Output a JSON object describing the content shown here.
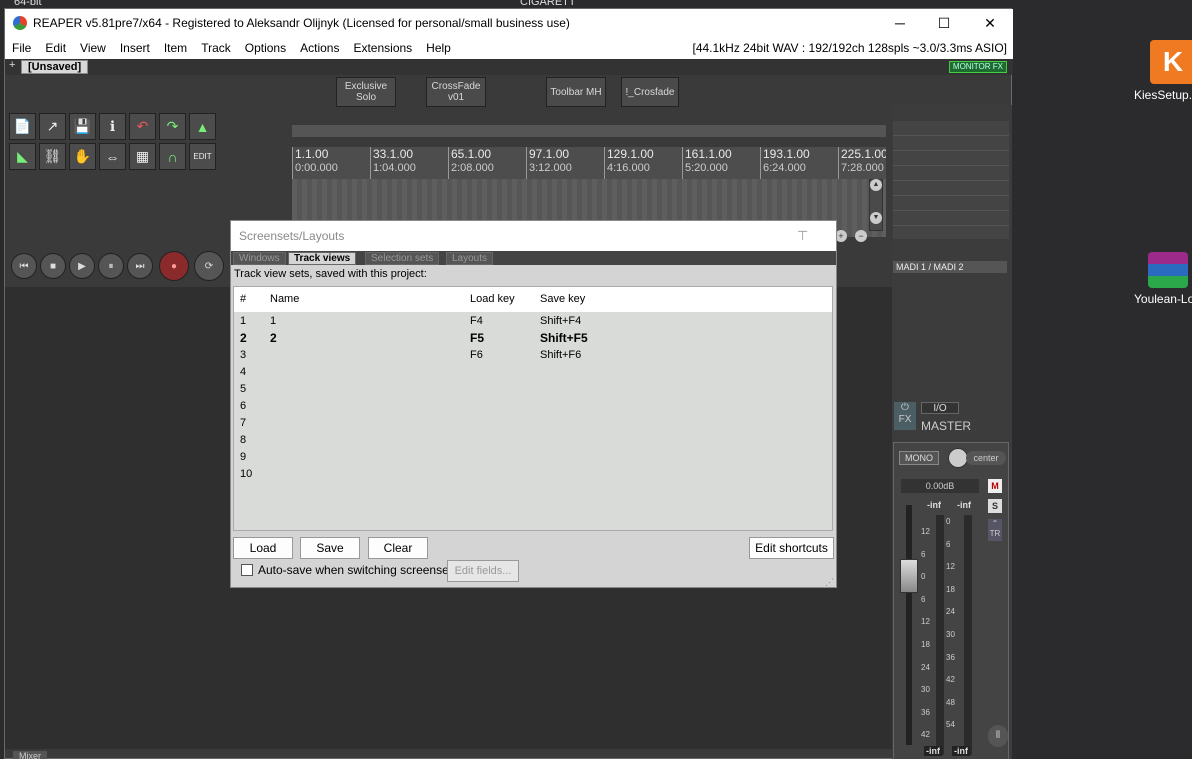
{
  "window": {
    "title": "REAPER v5.81pre7/x64 - Registered to Aleksandr Olijnyk (Licensed for personal/small business use)",
    "minimize": "─",
    "maximize": "☐",
    "close": "✕"
  },
  "menu": {
    "items": [
      "File",
      "Edit",
      "View",
      "Insert",
      "Item",
      "Track",
      "Options",
      "Actions",
      "Extensions",
      "Help"
    ],
    "status": "[44.1kHz 24bit WAV : 192/192ch 128spls ~3.0/3.3ms ASIO]"
  },
  "project": {
    "add_tab": "+",
    "tab_label": "[Unsaved]",
    "monitor_fx": "MONITOR FX"
  },
  "toolbar_buttons": [
    {
      "label": "Exclusive\nSolo"
    },
    {
      "label": "CrossFade\nv01"
    },
    {
      "label": "Toolbar MH"
    },
    {
      "label": "!_Crosfade"
    }
  ],
  "ruler": [
    {
      "bar": "1.1.00",
      "time": "0:00.000"
    },
    {
      "bar": "33.1.00",
      "time": "1:04.000"
    },
    {
      "bar": "65.1.00",
      "time": "2:08.000"
    },
    {
      "bar": "97.1.00",
      "time": "3:12.000"
    },
    {
      "bar": "129.1.00",
      "time": "4:16.000"
    },
    {
      "bar": "161.1.00",
      "time": "5:20.000"
    },
    {
      "bar": "193.1.00",
      "time": "6:24.000"
    },
    {
      "bar": "225.1.00",
      "time": "7:28.000"
    }
  ],
  "mixer": {
    "input": "MADI 1 / MADI 2",
    "io": "I/O",
    "master": "MASTER",
    "mono": "MONO",
    "pan": "center",
    "db": "0.00dB",
    "peak_l": "-inf",
    "peak_r": "-inf",
    "m": "M",
    "s": "S",
    "tr": "TR",
    "fx": "FX",
    "scale_left": [
      "12",
      "6",
      "0",
      "6",
      "12",
      "18",
      "24",
      "30",
      "36",
      "42"
    ],
    "scale_mid": [
      "0",
      "6",
      "12",
      "18",
      "24",
      "30",
      "36",
      "42",
      "48",
      "54"
    ],
    "bottom_l": "-inf",
    "bottom_r": "-inf",
    "mixer_tab": "Mixer"
  },
  "dialog": {
    "title": "Screensets/Layouts",
    "tabs": [
      "Windows",
      "Track views",
      "Selection sets",
      "Layouts"
    ],
    "subtitle": "Track view sets, saved with this project:",
    "columns": {
      "num": "#",
      "name": "Name",
      "load": "Load key",
      "save": "Save key"
    },
    "rows": [
      {
        "num": "1",
        "name": "1",
        "load": "F4",
        "save": "Shift+F4",
        "bold": false
      },
      {
        "num": "2",
        "name": "2",
        "load": "F5",
        "save": "Shift+F5",
        "bold": true
      },
      {
        "num": "3",
        "name": "",
        "load": "F6",
        "save": "Shift+F6",
        "bold": false
      },
      {
        "num": "4",
        "name": "",
        "load": "",
        "save": "",
        "bold": false
      },
      {
        "num": "5",
        "name": "",
        "load": "",
        "save": "",
        "bold": false
      },
      {
        "num": "6",
        "name": "",
        "load": "",
        "save": "",
        "bold": false
      },
      {
        "num": "7",
        "name": "",
        "load": "",
        "save": "",
        "bold": false
      },
      {
        "num": "8",
        "name": "",
        "load": "",
        "save": "",
        "bold": false
      },
      {
        "num": "9",
        "name": "",
        "load": "",
        "save": "",
        "bold": false
      },
      {
        "num": "10",
        "name": "",
        "load": "",
        "save": "",
        "bold": false
      }
    ],
    "load_btn": "Load",
    "save_btn": "Save",
    "clear_btn": "Clear",
    "edit_shortcuts_btn": "Edit shortcuts",
    "autosave_label": "Auto-save when switching screensets",
    "edit_fields_btn": "Edit fields..."
  },
  "desktop": {
    "top_left_1": "64-bit",
    "top_center": "CIGARETT",
    "icons": [
      {
        "label": "KiesSetup.e"
      },
      {
        "label": "Youlean-Lo"
      }
    ]
  }
}
